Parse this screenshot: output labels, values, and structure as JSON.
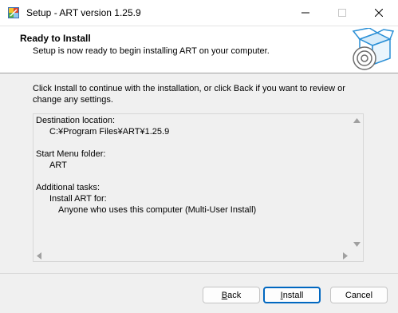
{
  "window": {
    "title": "Setup - ART version 1.25.9",
    "controls": [
      "minimize-icon",
      "maximize-icon",
      "close-icon"
    ]
  },
  "header": {
    "title": "Ready to Install",
    "subtitle": "Setup is now ready to begin installing ART on your computer."
  },
  "intro": "Click Install to continue with the installation, or click Back if you want to review or change any settings.",
  "memo": {
    "lines": [
      {
        "text": "Destination location:",
        "indent": 0
      },
      {
        "text": "C:¥Program Files¥ART¥1.25.9",
        "indent": 1
      },
      {
        "text": "",
        "indent": 0
      },
      {
        "text": "Start Menu folder:",
        "indent": 0
      },
      {
        "text": "ART",
        "indent": 1
      },
      {
        "text": "",
        "indent": 0
      },
      {
        "text": "Additional tasks:",
        "indent": 0
      },
      {
        "text": "Install ART for:",
        "indent": 1
      },
      {
        "text": "Anyone who uses this computer (Multi-User Install)",
        "indent": 2
      }
    ]
  },
  "buttons": {
    "back_rest": "ack",
    "back_hotkey": "B",
    "install_hotkey": "I",
    "install_rest": "nstall",
    "cancel": "Cancel"
  },
  "colors": {
    "accent": "#0067c0",
    "background": "#f0f0f0",
    "header_bg": "#ffffff"
  }
}
